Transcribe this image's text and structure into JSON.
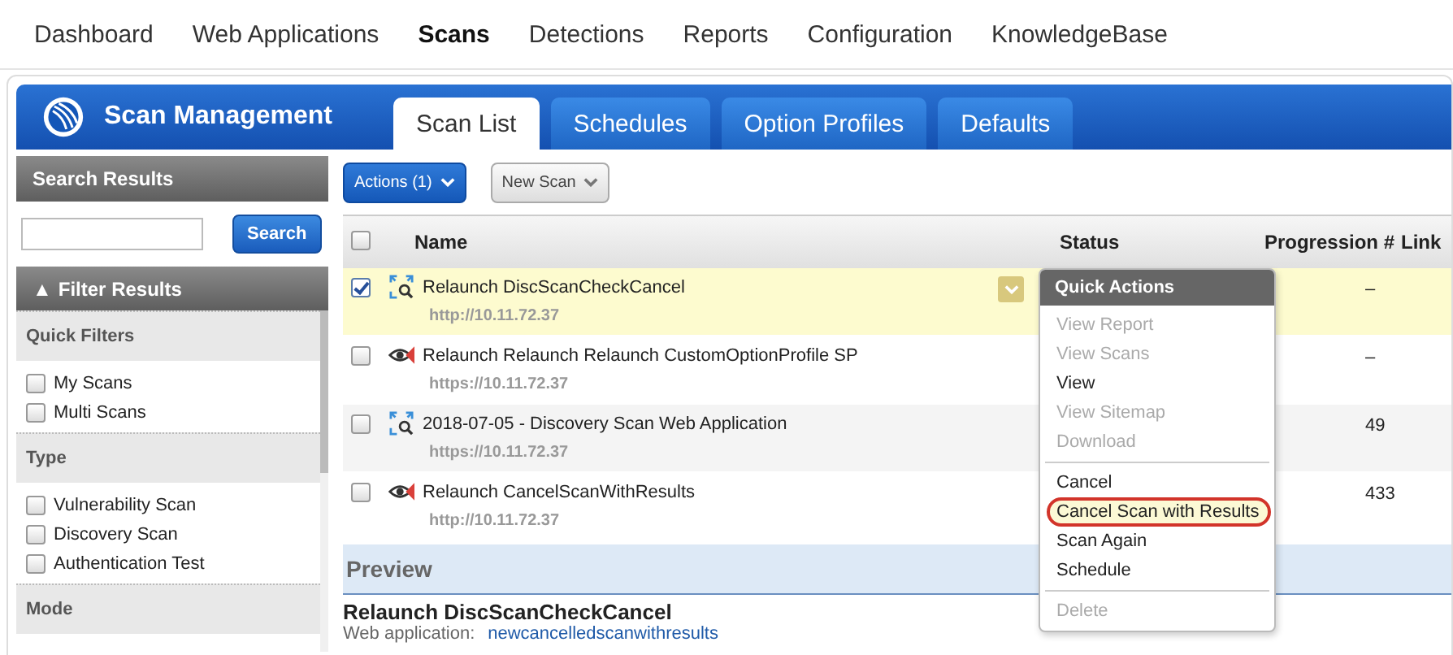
{
  "nav": [
    {
      "label": "Dashboard",
      "selected": false
    },
    {
      "label": "Web Applications",
      "selected": false
    },
    {
      "label": "Scans",
      "selected": true
    },
    {
      "label": "Detections",
      "selected": false
    },
    {
      "label": "Reports",
      "selected": false
    },
    {
      "label": "Configuration",
      "selected": false
    },
    {
      "label": "KnowledgeBase",
      "selected": false
    }
  ],
  "header": {
    "title": "Scan Management"
  },
  "tabs": [
    {
      "label": "Scan List",
      "selected": true
    },
    {
      "label": "Schedules",
      "selected": false
    },
    {
      "label": "Option Profiles",
      "selected": false
    },
    {
      "label": "Defaults",
      "selected": false
    }
  ],
  "sidebar": {
    "search_title": "Search Results",
    "search_button": "Search",
    "filter_title": "Filter Results",
    "filter_toggle": "▲",
    "sections": [
      {
        "title": "Quick Filters",
        "items": [
          {
            "label": "My Scans",
            "checked": false
          },
          {
            "label": "Multi Scans",
            "checked": false
          }
        ]
      },
      {
        "title": "Type",
        "items": [
          {
            "label": "Vulnerability Scan",
            "checked": false
          },
          {
            "label": "Discovery Scan",
            "checked": false
          },
          {
            "label": "Authentication Test",
            "checked": false
          }
        ]
      },
      {
        "title": "Mode"
      }
    ]
  },
  "toolbar": {
    "actions_button": "Actions (1)",
    "new_scan_button": "New Scan"
  },
  "table": {
    "all_checked": false,
    "columns": [
      "Name",
      "Status",
      "Progression #",
      "Link"
    ],
    "rows": [
      {
        "name": "Relaunch DiscScanCheckCancel",
        "url": "http://10.11.72.37",
        "kind": "discovery",
        "checked": true,
        "selected": true,
        "links": "–"
      },
      {
        "name": "Relaunch Relaunch Relaunch CustomOptionProfile SP",
        "url": "https://10.11.72.37",
        "kind": "vulnerability",
        "checked": false,
        "selected": false,
        "links": "–"
      },
      {
        "name": "2018-07-05 - Discovery Scan Web Application",
        "url": "https://10.11.72.37",
        "kind": "discovery",
        "checked": false,
        "selected": false,
        "links": "49"
      },
      {
        "name": "Relaunch CancelScanWithResults",
        "url": "http://10.11.72.37",
        "kind": "vulnerability",
        "checked": false,
        "selected": false,
        "links": "433"
      }
    ]
  },
  "quick_actions": {
    "title": "Quick Actions",
    "groups": [
      [
        {
          "label": "View Report",
          "disabled": true,
          "highlighted": false
        },
        {
          "label": "View Scans",
          "disabled": true,
          "highlighted": false
        },
        {
          "label": "View",
          "disabled": false,
          "highlighted": false
        },
        {
          "label": "View Sitemap",
          "disabled": true,
          "highlighted": false
        },
        {
          "label": "Download",
          "disabled": true,
          "highlighted": false
        }
      ],
      [
        {
          "label": "Cancel",
          "disabled": false,
          "highlighted": false
        },
        {
          "label": "Cancel Scan with Results",
          "disabled": false,
          "highlighted": true
        },
        {
          "label": "Scan Again",
          "disabled": false,
          "highlighted": false
        },
        {
          "label": "Schedule",
          "disabled": false,
          "highlighted": false
        }
      ],
      [
        {
          "label": "Delete",
          "disabled": true,
          "highlighted": false
        }
      ]
    ]
  },
  "preview": {
    "title": "Preview",
    "scan_name": "Relaunch DiscScanCheckCancel",
    "field_label": "Web application:",
    "field_value": "newcancelledscanwithresults"
  }
}
